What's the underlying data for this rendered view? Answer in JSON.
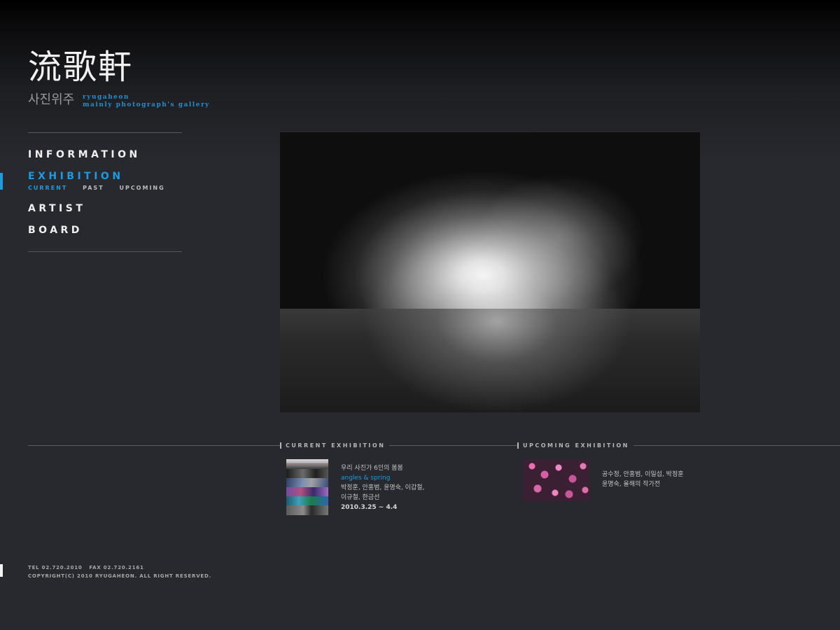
{
  "logo": {
    "hanja": "流歌軒",
    "korean": "사진위주",
    "roman_line1": "ryugaheon",
    "roman_line2": "mainly photograph's gallery"
  },
  "nav": {
    "items": [
      {
        "label": "INFORMATION",
        "active": false
      },
      {
        "label": "EXHIBITION",
        "active": true
      },
      {
        "label": "ARTIST",
        "active": false
      },
      {
        "label": "BOARD",
        "active": false
      }
    ],
    "exhibition_sub": [
      {
        "label": "CURRENT",
        "active": true
      },
      {
        "label": "PAST",
        "active": false
      },
      {
        "label": "UPCOMING",
        "active": false
      }
    ]
  },
  "sections": {
    "current_label": "CURRENT EXHIBITION",
    "upcoming_label": "UPCOMING EXHIBITION"
  },
  "current_exhibition": {
    "line1": "우리 사진가 6인의 봄봄",
    "title": "angles & spring",
    "artists_line1": "박정훈, 안홍범, 윤명숙, 이갑철,",
    "artists_line2": "이규철, 한금선",
    "dates": "2010.3.25 ~ 4.4"
  },
  "upcoming_exhibition": {
    "line1": "공수정, 안홍범, 이일섭, 박정훈",
    "line2": "윤명숙, 올해의 작가전"
  },
  "footer": {
    "contact": "TEL 02.720.2010   FAX 02.720.2161",
    "copyright": "COPYRIGHT(C) 2010 RYUGAHEON. ALL RIGHT RESERVED."
  },
  "colors": {
    "accent": "#1e9be0",
    "background": "#28292e",
    "nav_text": "#f0f0f0"
  }
}
